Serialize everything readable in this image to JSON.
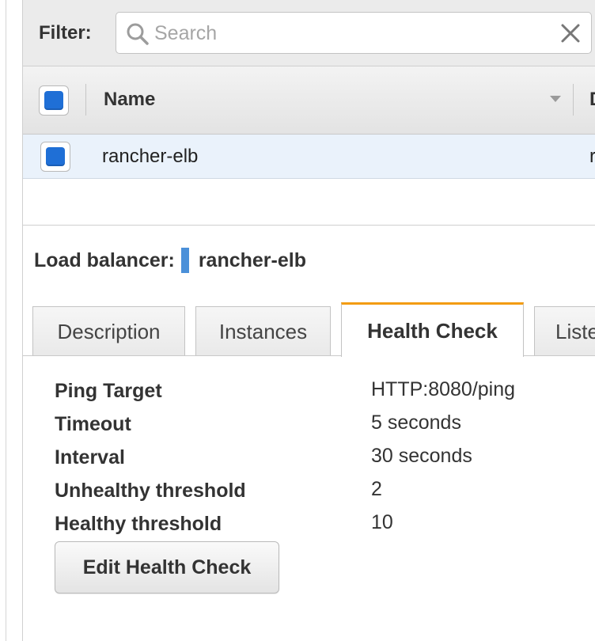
{
  "filter": {
    "label": "Filter:",
    "search_placeholder": "Search",
    "search_value": ""
  },
  "table": {
    "columns": [
      "Name",
      "D"
    ],
    "rows": [
      {
        "name": "rancher-elb",
        "next_col_fragment": "r"
      }
    ]
  },
  "details": {
    "label": "Load balancer:",
    "value": "rancher-elb"
  },
  "tabs": [
    {
      "label": "Description",
      "active": false
    },
    {
      "label": "Instances",
      "active": false
    },
    {
      "label": "Health Check",
      "active": true
    },
    {
      "label": "Listeners",
      "active": false
    }
  ],
  "health_check": {
    "rows": [
      {
        "label": "Ping Target",
        "value": "HTTP:8080/ping"
      },
      {
        "label": "Timeout",
        "value": "5 seconds"
      },
      {
        "label": "Interval",
        "value": "30 seconds"
      },
      {
        "label": "Unhealthy threshold",
        "value": "2"
      },
      {
        "label": "Healthy threshold",
        "value": "10"
      }
    ],
    "edit_button": "Edit Health Check"
  },
  "colors": {
    "checkbox_blue": "#1f6fd6",
    "active_tab_accent": "#f39c12",
    "title_accent": "#4a90d9",
    "selected_row": "#eaf2fb"
  },
  "icons": {
    "search": "search-icon",
    "clear": "close-icon",
    "sort": "sort-caret-icon"
  }
}
